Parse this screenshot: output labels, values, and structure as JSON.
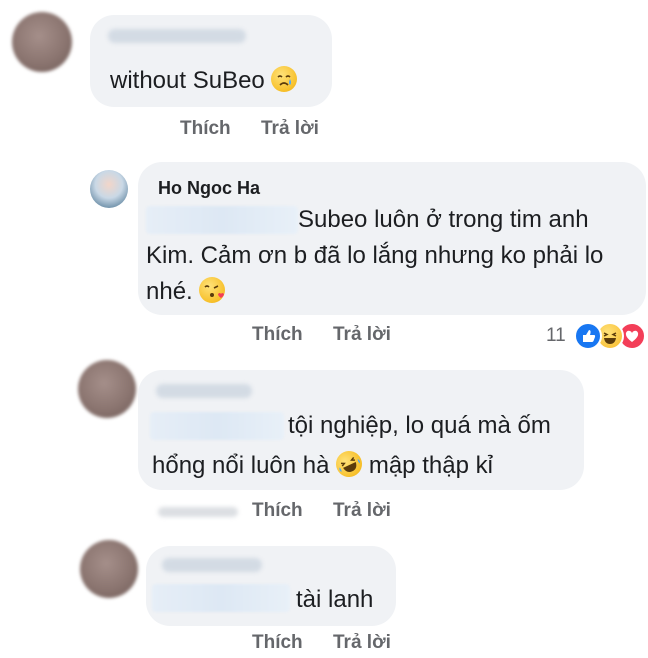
{
  "comments": [
    {
      "text_lines": [
        "without SuBeo"
      ],
      "emoji_icon": "crying-face-icon",
      "actions": {
        "like": "Thích",
        "reply": "Trả lời"
      }
    },
    {
      "author": "Ho Ngoc Ha",
      "text_lines": [
        "Subeo luôn ở trong tim anh",
        "Kim. Cảm ơn b đã lo lắng nhưng ko phải lo",
        "nhé."
      ],
      "emoji_icon": "face-blowing-kiss-icon",
      "actions": {
        "like": "Thích",
        "reply": "Trả lời"
      },
      "reactions": {
        "count": "11",
        "icons": [
          "like-reaction-icon",
          "haha-reaction-icon",
          "love-reaction-icon"
        ]
      }
    },
    {
      "text_lines": [
        "tội nghiệp, lo quá mà ốm",
        "hổng nổi luôn hà",
        "mập thập kỉ"
      ],
      "emoji_icon": "rolling-laughing-face-icon",
      "actions": {
        "like": "Thích",
        "reply": "Trả lời"
      }
    },
    {
      "text_lines": [
        "tài lanh"
      ],
      "actions": {
        "like": "Thích",
        "reply": "Trả lời"
      }
    }
  ],
  "colors": {
    "bubble": "#f0f2f5",
    "action": "#65676b",
    "like": "#1877f2",
    "love": "#f33e58",
    "haha": "#f7b928"
  }
}
